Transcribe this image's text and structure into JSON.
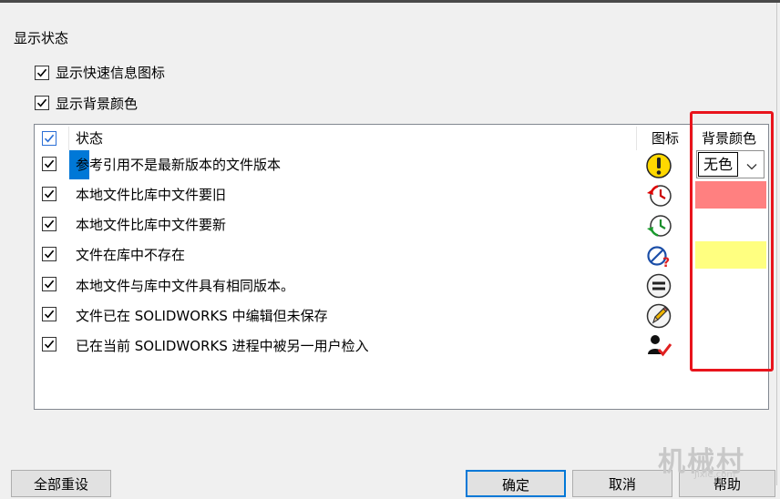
{
  "group_title": "显示状态",
  "options": [
    {
      "label": "显示快速信息图标",
      "checked": true
    },
    {
      "label": "显示背景颜色",
      "checked": true
    }
  ],
  "table": {
    "columns": {
      "status": "状态",
      "icon": "图标",
      "bg_color": "背景颜色"
    },
    "rows": [
      {
        "checked": true,
        "status": "参考引用不是最新版本的文件版本",
        "icon": "warning-exclamation-icon",
        "bg": "#ffffff"
      },
      {
        "checked": true,
        "status": "本地文件比库中文件要旧",
        "icon": "clock-older-icon",
        "bg": "#ff8080"
      },
      {
        "checked": true,
        "status": "本地文件比库中文件要新",
        "icon": "clock-newer-icon",
        "bg": "#ffffff"
      },
      {
        "checked": true,
        "status": "文件在库中不存在",
        "icon": "not-in-vault-icon",
        "bg": "#ffff80"
      },
      {
        "checked": true,
        "status": "本地文件与库中文件具有相同版本。",
        "icon": "equal-version-icon",
        "bg": "#ffffff"
      },
      {
        "checked": true,
        "status": "文件已在 SOLIDWORKS 中编辑但未保存",
        "icon": "edited-pencil-icon",
        "bg": "#ffffff"
      },
      {
        "checked": true,
        "status": "已在当前 SOLIDWORKS 进程中被另一用户检入",
        "icon": "checked-in-user-icon",
        "bg": "#ffffff"
      }
    ],
    "color_select_value": "无色"
  },
  "buttons": {
    "reset": "全部重设",
    "ok": "确定",
    "cancel": "取消",
    "help": "帮助"
  },
  "watermark": {
    "text": "机械村",
    "sub": "Jixie.com"
  },
  "colors": {
    "highlight_box": "#e8141c",
    "selection": "#0078d7",
    "older_bg": "#ff8080",
    "missing_bg": "#ffff80"
  }
}
